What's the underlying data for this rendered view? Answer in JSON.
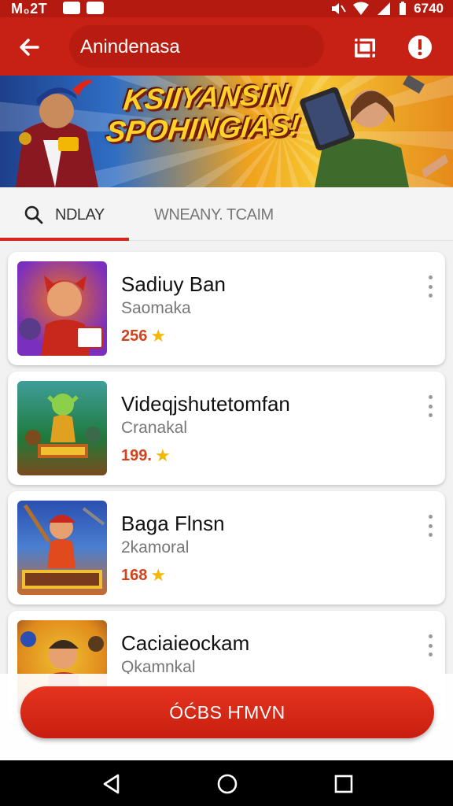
{
  "status_bar": {
    "time_left": "M₀2T",
    "time_right": "6740"
  },
  "app_bar": {
    "title": "Anindenasa"
  },
  "banner": {
    "title_line1": "KSIIYANSIN",
    "title_line2": "SPOHINGIAS!"
  },
  "tabs": [
    {
      "label": "NDLAY",
      "active": true,
      "icon": "search-icon"
    },
    {
      "label": "WNEANY. TCAIM",
      "active": false
    }
  ],
  "games": [
    {
      "title": "Sadiuy Ban",
      "subtitle": "Saomaka",
      "rating": "256",
      "thumb_colors": [
        "#7b2fbf",
        "#f0701c",
        "#c8281c"
      ]
    },
    {
      "title": "Videqjshutetomfan",
      "subtitle": "Cranakal",
      "rating": "199.",
      "thumb_colors": [
        "#1f7a3c",
        "#e0a020",
        "#7a4b1c"
      ]
    },
    {
      "title": "Baga Flnsn",
      "subtitle": "2kamoral",
      "rating": "168",
      "thumb_colors": [
        "#2a4fb0",
        "#e04a1c",
        "#f0c030"
      ]
    },
    {
      "title": "Caciaieockam",
      "subtitle": "Qkamnkal",
      "rating": "",
      "thumb_colors": [
        "#e08a1c",
        "#c8281c",
        "#5a3a1c"
      ]
    }
  ],
  "cta": {
    "label": "ÓĆBS ҤMVN"
  },
  "colors": {
    "accent": "#c62114",
    "status": "#b51a10",
    "star": "#f2b705"
  }
}
